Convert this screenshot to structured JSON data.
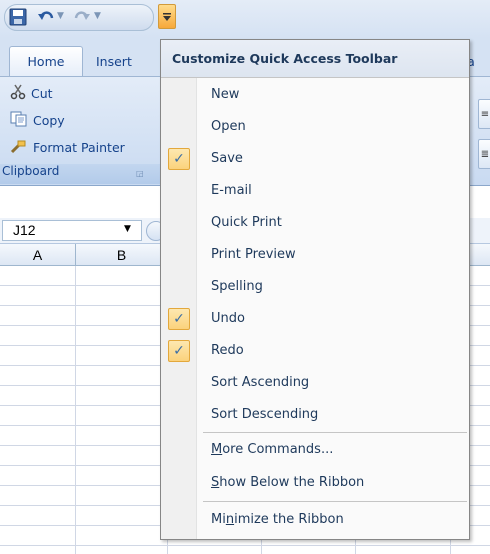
{
  "quick_access": {
    "icons": [
      "save-icon",
      "undo-icon",
      "redo-icon",
      "customize-toolbar-icon"
    ]
  },
  "tabs": [
    "Home",
    "Insert",
    "Data"
  ],
  "ribbon": {
    "clipboard": {
      "cut": "Cut",
      "copy": "Copy",
      "format_painter": "Format Painter",
      "group_label": "Clipboard"
    }
  },
  "formula_bar": {
    "name_box": "J12"
  },
  "columns": [
    "A",
    "B"
  ],
  "menu": {
    "title": "Customize Quick Access Toolbar",
    "items": [
      {
        "label": "New",
        "checked": false
      },
      {
        "label": "Open",
        "checked": false
      },
      {
        "label": "Save",
        "checked": true
      },
      {
        "label": "E-mail",
        "checked": false
      },
      {
        "label": "Quick Print",
        "checked": false
      },
      {
        "label": "Print Preview",
        "checked": false
      },
      {
        "label": "Spelling",
        "checked": false
      },
      {
        "label": "Undo",
        "checked": true
      },
      {
        "label": "Redo",
        "checked": true
      },
      {
        "label": "Sort Ascending",
        "checked": false
      },
      {
        "label": "Sort Descending",
        "checked": false
      }
    ],
    "more_commands": {
      "mnemonic": "M",
      "rest": "ore Commands..."
    },
    "show_below": {
      "mnemonic": "S",
      "rest": "how Below the Ribbon"
    },
    "minimize": {
      "pre": "Mi",
      "mnemonic": "n",
      "rest": "imize the Ribbon"
    },
    "check_mark": "✓"
  },
  "colors": {
    "accent_orange": "#f7a83a",
    "ribbon_blue": "#d5e2f3",
    "text_blue": "#15428b"
  }
}
